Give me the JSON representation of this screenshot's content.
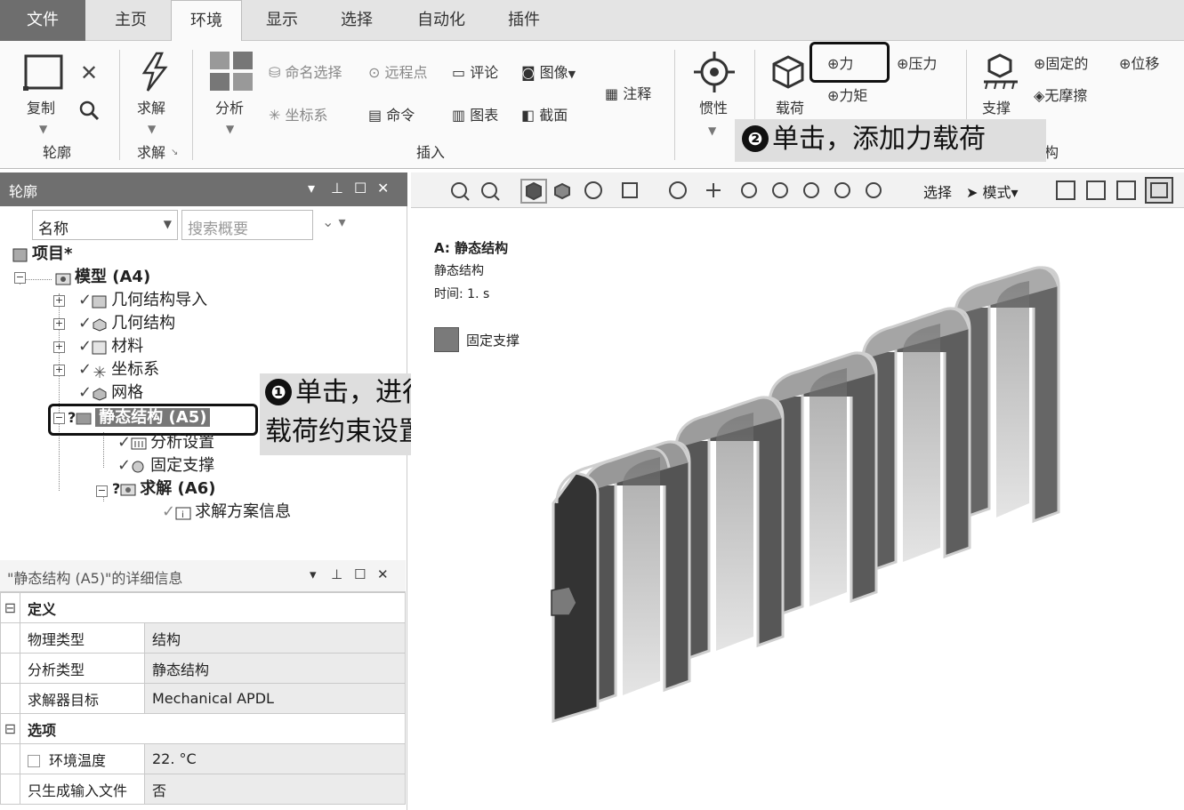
{
  "tabs": [
    {
      "label": "文件"
    },
    {
      "label": "主页"
    },
    {
      "label": "环境"
    },
    {
      "label": "显示"
    },
    {
      "label": "选择"
    },
    {
      "label": "自动化"
    },
    {
      "label": "插件"
    }
  ],
  "ribbon": {
    "outline_group": {
      "copy": "复制",
      "label": "轮廓"
    },
    "solve_group": {
      "solve": "求解",
      "label": "求解"
    },
    "analysis": "分析",
    "insert_group": {
      "named_selection": "命名选择",
      "remote_point": "远程点",
      "comment": "评论",
      "image": "图像",
      "coordinate_system": "坐标系",
      "command": "命令",
      "chart": "图表",
      "section": "截面",
      "annotation": "注释",
      "label": "插入"
    },
    "inertia": "惯性",
    "loads": {
      "label": "载荷",
      "force": "力",
      "pressure": "压力",
      "moment": "力矩"
    },
    "supports": {
      "label": "支撑",
      "fixed": "固定的",
      "displacement": "位移",
      "frictionless": "无摩擦"
    },
    "partial_group_label": "构"
  },
  "callouts": {
    "force": {
      "num": "❷",
      "text": "单击，添加力载荷"
    },
    "static": {
      "num": "❶",
      "line1": "单击，进行",
      "line2": "载荷约束设置"
    }
  },
  "outline": {
    "title": "轮廓",
    "filter_label": "名称",
    "search_placeholder": "搜索概要",
    "tree": [
      {
        "label": "项目*",
        "bold": true
      },
      {
        "label": "模型 (A4)",
        "bold": true
      },
      {
        "label": "几何结构导入"
      },
      {
        "label": "几何结构"
      },
      {
        "label": "材料"
      },
      {
        "label": "坐标系"
      },
      {
        "label": "网格"
      },
      {
        "label": "静态结构 (A5)",
        "bold": true,
        "prefix": "?"
      },
      {
        "label": "分析设置"
      },
      {
        "label": "固定支撑"
      },
      {
        "label": "求解 (A6)",
        "bold": true,
        "prefix": "?"
      },
      {
        "label": "求解方案信息"
      }
    ]
  },
  "details": {
    "title": "\"静态结构 (A5)\"的详细信息",
    "sections": [
      {
        "name": "定义",
        "rows": [
          {
            "key": "物理类型",
            "value": "结构"
          },
          {
            "key": "分析类型",
            "value": "静态结构"
          },
          {
            "key": "求解器目标",
            "value": "Mechanical APDL"
          }
        ]
      },
      {
        "name": "选项",
        "rows": [
          {
            "key": "环境温度",
            "value": "22. °C"
          },
          {
            "key": "只生成输入文件",
            "value": "否"
          }
        ]
      }
    ]
  },
  "view_toolbar": {
    "select": "选择",
    "mode": "模式"
  },
  "viewport": {
    "title": "A: 静态结构",
    "subtitle": "静态结构",
    "time": "时间: 1. s",
    "legend": "固定支撑"
  },
  "colors": {
    "file_tab": "#6e6e6e",
    "panel_header": "#6f6f6f",
    "callout_bg": "#dedede",
    "legend_swatch": "#7a7a7a"
  }
}
